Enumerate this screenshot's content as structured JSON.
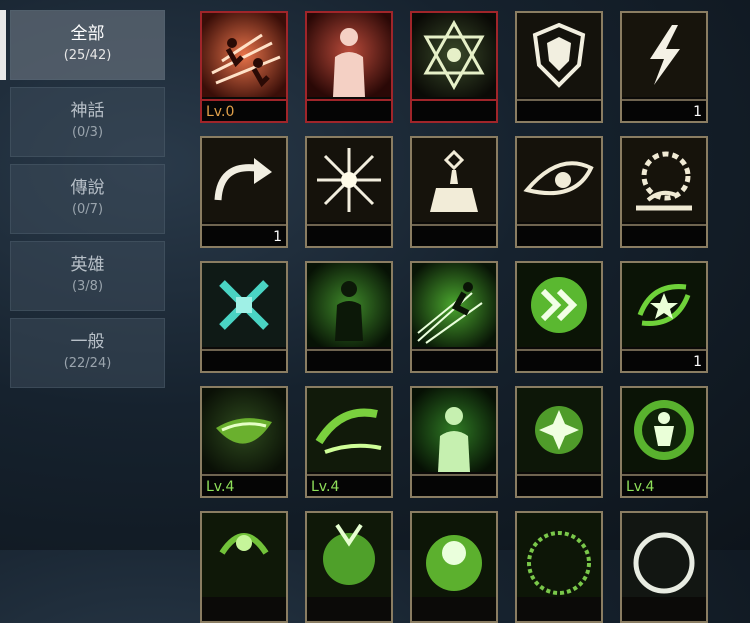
{
  "categories": [
    {
      "name": "全部",
      "count": "(25/42)",
      "active": true
    },
    {
      "name": "神話",
      "count": "(0/3)"
    },
    {
      "name": "傳說",
      "count": "(0/7)"
    },
    {
      "name": "英雄",
      "count": "(3/8)"
    },
    {
      "name": "一般",
      "count": "(22/24)"
    }
  ],
  "skills": [
    {
      "icon": "dash-attack-icon",
      "level": "Lv.0",
      "level_color": "#e0a04a",
      "highlight": "red"
    },
    {
      "icon": "human-silhouette-icon",
      "highlight": "red"
    },
    {
      "icon": "star-rune-icon",
      "highlight": "red"
    },
    {
      "icon": "shield-icon"
    },
    {
      "icon": "lightning-icon",
      "count": "1"
    },
    {
      "icon": "curved-arrow-icon",
      "count": "1"
    },
    {
      "icon": "burst-icon"
    },
    {
      "icon": "pedestal-icon"
    },
    {
      "icon": "eye-icon"
    },
    {
      "icon": "spiked-wheel-icon"
    },
    {
      "icon": "crossed-blades-icon"
    },
    {
      "icon": "human-aura-icon"
    },
    {
      "icon": "sprint-icon"
    },
    {
      "icon": "double-chevron-icon"
    },
    {
      "icon": "rune-star-icon",
      "count": "1"
    },
    {
      "icon": "green-slash-icon",
      "level": "Lv.4",
      "level_color": "#8fe05a"
    },
    {
      "icon": "green-whirl-icon",
      "level": "Lv.4",
      "level_color": "#8fe05a"
    },
    {
      "icon": "green-silhouette-icon"
    },
    {
      "icon": "green-flower-icon"
    },
    {
      "icon": "green-armor-icon",
      "level": "Lv.4",
      "level_color": "#8fe05a"
    },
    {
      "icon": "green-beast-icon"
    },
    {
      "icon": "green-orb-icon"
    },
    {
      "icon": "green-ram-icon"
    },
    {
      "icon": "green-rune-circle-icon"
    },
    {
      "icon": "green-ring-icon"
    }
  ]
}
